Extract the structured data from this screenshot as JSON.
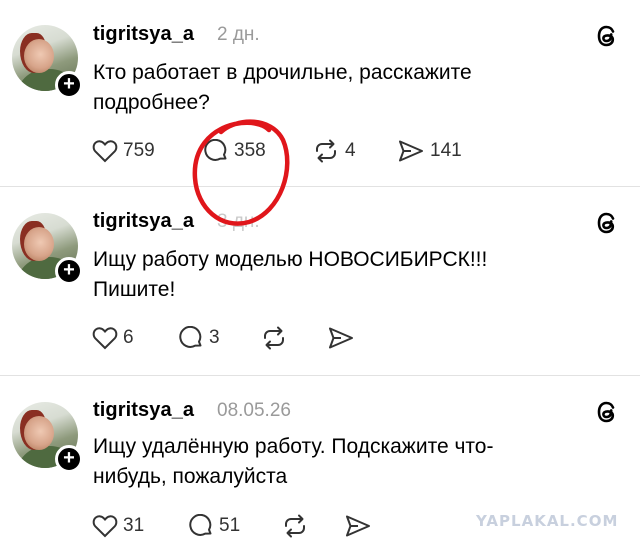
{
  "posts": [
    {
      "username": "tigritsya_a",
      "date": "2 дн.",
      "text": "Кто работает в дрочильне, расскажите подробнее?",
      "likes": "759",
      "comments": "358",
      "reposts": "4",
      "shares": "141"
    },
    {
      "username": "tigritsya_a",
      "date": "3 дн.",
      "text": "Ищу работу моделью НОВОСИБИРСК!!! Пишите!",
      "likes": "6",
      "comments": "3",
      "reposts": "",
      "shares": ""
    },
    {
      "username": "tigritsya_a",
      "date": "08.05.26",
      "text": "Ищу удалённую работу. Подскажите что-нибудь, пожалуйста",
      "likes": "31",
      "comments": "51",
      "reposts": "",
      "shares": ""
    }
  ],
  "annotation_color": "#e0161b",
  "watermark": "YAPLAKAL.COM",
  "icons": [
    "heart-icon",
    "comment-icon",
    "repost-icon",
    "share-icon",
    "threads-logo-icon",
    "plus-icon"
  ]
}
